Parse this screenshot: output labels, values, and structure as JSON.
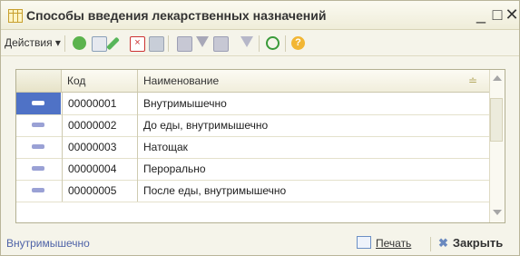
{
  "window": {
    "title": "Способы введения лекарственных назначений",
    "controls": {
      "minimize": "_",
      "maximize": "□",
      "close": "✕"
    }
  },
  "toolbar": {
    "actions_label": "Действия",
    "actions_arrow": "▾",
    "icons": [
      "add-icon",
      "copy-icon",
      "edit-icon",
      "delete-icon",
      "save-icon",
      "filter-set-icon",
      "filter-icon",
      "filter-dropdown-icon",
      "filter-clear-icon",
      "refresh-icon",
      "help-icon"
    ]
  },
  "table": {
    "columns": {
      "code": "Код",
      "name": "Наименование",
      "sort_indicator": "≐"
    },
    "rows": [
      {
        "code": "00000001",
        "name": "Внутримышечно",
        "selected": true
      },
      {
        "code": "00000002",
        "name": "До еды, внутримышечно",
        "selected": false
      },
      {
        "code": "00000003",
        "name": "Натощак",
        "selected": false
      },
      {
        "code": "00000004",
        "name": "Перорально",
        "selected": false
      },
      {
        "code": "00000005",
        "name": "После еды, внутримышечно",
        "selected": false
      }
    ]
  },
  "statusbar": {
    "selected_text": "Внутримышечно",
    "print_label": "Печать",
    "close_label": "Закрыть"
  },
  "colors": {
    "accent": "#4f72c6",
    "marker": "#9aa1d5"
  }
}
